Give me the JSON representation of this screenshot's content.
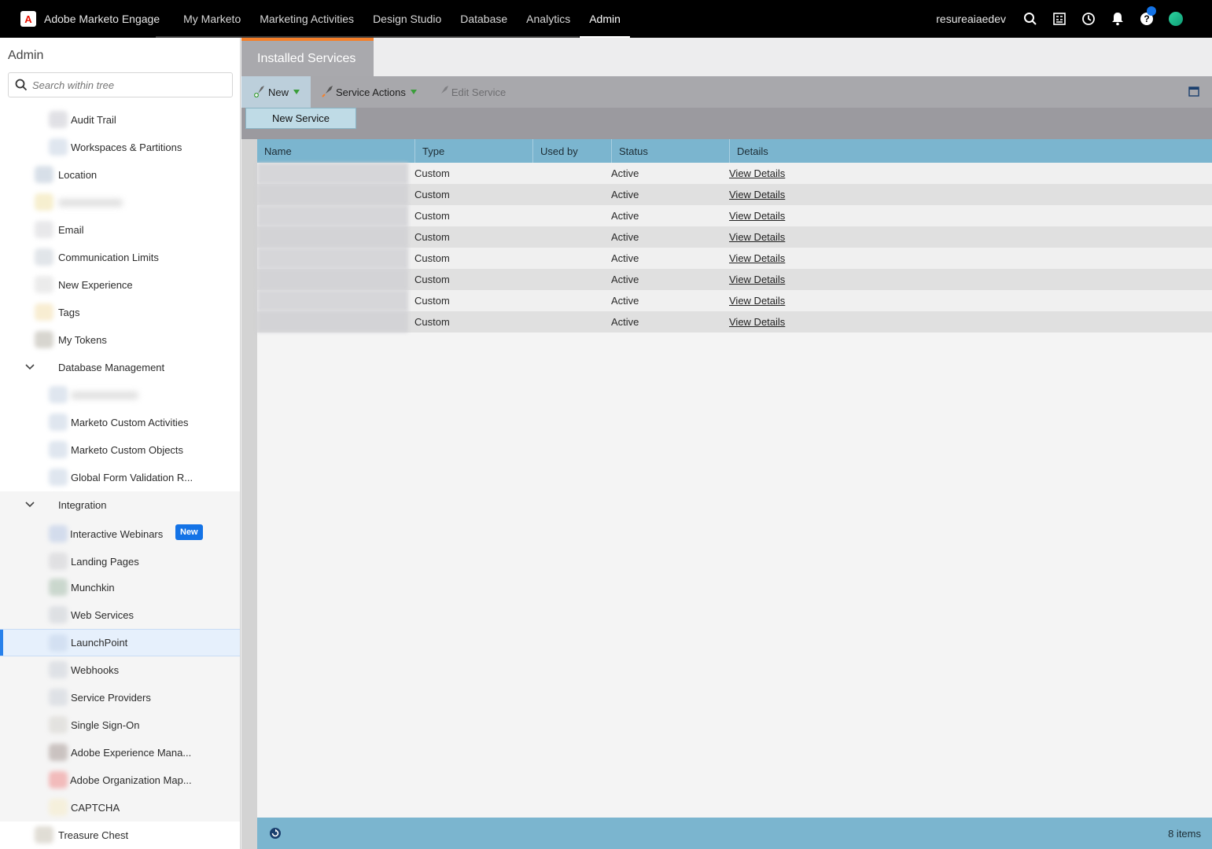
{
  "topbar": {
    "brand": "Adobe Marketo Engage",
    "nav": [
      "My Marketo",
      "Marketing Activities",
      "Design Studio",
      "Database",
      "Analytics",
      "Admin"
    ],
    "active_nav": "Admin",
    "username": "resureaiaedev",
    "icons": [
      "search-icon",
      "task-list-icon",
      "history-icon",
      "bell-icon",
      "help-icon",
      "avatar"
    ]
  },
  "sidebar": {
    "title": "Admin",
    "search_placeholder": "Search within tree",
    "items": [
      {
        "label": "Audit Trail"
      },
      {
        "label": "Workspaces & Partitions"
      },
      {
        "label": "Location"
      },
      {
        "label": "Email"
      },
      {
        "label": "Communication Limits"
      },
      {
        "label": "New Experience"
      },
      {
        "label": "Tags"
      },
      {
        "label": "My Tokens"
      },
      {
        "label": "Database Management"
      },
      {
        "label": "Marketo Custom Activities"
      },
      {
        "label": "Marketo Custom Objects"
      },
      {
        "label": "Global Form Validation R..."
      },
      {
        "label": "Integration"
      },
      {
        "label": "Interactive Webinars"
      },
      {
        "label": "Landing Pages"
      },
      {
        "label": "Munchkin"
      },
      {
        "label": "Web Services"
      },
      {
        "label": "LaunchPoint"
      },
      {
        "label": "Webhooks"
      },
      {
        "label": "Service Providers"
      },
      {
        "label": "Single Sign-On"
      },
      {
        "label": "Adobe Experience Mana..."
      },
      {
        "label": "Adobe Organization Map..."
      },
      {
        "label": "CAPTCHA"
      },
      {
        "label": "Treasure Chest"
      }
    ],
    "badge_new": "New",
    "selected": "LaunchPoint"
  },
  "main": {
    "tab": "Installed Services",
    "toolbar": {
      "new_label": "New",
      "service_actions_label": "Service Actions",
      "edit_service_label": "Edit Service"
    },
    "dropdown_item": "New Service",
    "grid": {
      "columns": [
        "Name",
        "Type",
        "Used by",
        "Status",
        "Details"
      ],
      "rows": [
        {
          "type": "Custom",
          "status": "Active",
          "details": "View Details"
        },
        {
          "type": "Custom",
          "status": "Active",
          "details": "View Details"
        },
        {
          "type": "Custom",
          "status": "Active",
          "details": "View Details"
        },
        {
          "type": "Custom",
          "status": "Active",
          "details": "View Details"
        },
        {
          "type": "Custom",
          "status": "Active",
          "details": "View Details"
        },
        {
          "type": "Custom",
          "status": "Active",
          "details": "View Details"
        },
        {
          "type": "Custom",
          "status": "Active",
          "details": "View Details"
        },
        {
          "type": "Custom",
          "status": "Active",
          "details": "View Details"
        }
      ]
    },
    "footer_count": "8 items"
  },
  "colors": {
    "accent_orange": "#f47f2a",
    "grid_header": "#7bb5cf",
    "selected_blue": "#2680eb",
    "badge_blue": "#1473e6"
  }
}
